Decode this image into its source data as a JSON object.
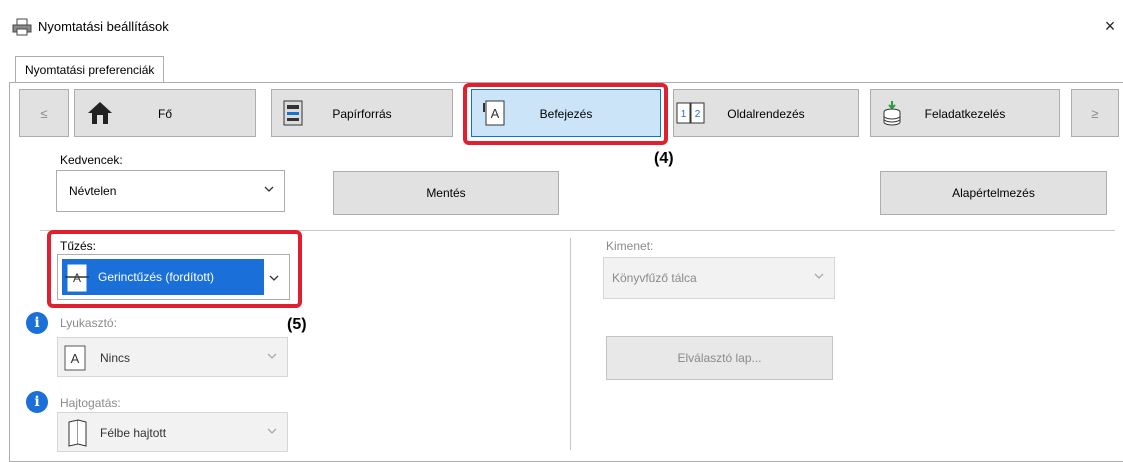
{
  "window": {
    "title": "Nyomtatási beállítások",
    "close": "×"
  },
  "tabs": {
    "active": "Nyomtatási preferenciák"
  },
  "nav": {
    "prev": "≤",
    "next": "≥",
    "items": [
      {
        "label": "Fő",
        "icon": "home-icon"
      },
      {
        "label": "Papírforrás",
        "icon": "paper-tray-icon"
      },
      {
        "label": "Befejezés",
        "icon": "finishing-icon"
      },
      {
        "label": "Oldalrendezés",
        "icon": "page-layout-icon"
      },
      {
        "label": "Feladatkezelés",
        "icon": "job-handling-icon"
      }
    ],
    "active_index": 2
  },
  "favorites": {
    "label": "Kedvencek:",
    "value": "Névtelen",
    "save_label": "Mentés",
    "defaults_label": "Alapértelmezés"
  },
  "stapling": {
    "label": "Tűzés:",
    "value": "Gerinctűzés (fordított)"
  },
  "punch": {
    "label": "Lyukasztó:",
    "value": "Nincs"
  },
  "fold": {
    "label": "Hajtogatás:",
    "value": "Félbe hajtott"
  },
  "output": {
    "label": "Kimenet:",
    "value": "Könyvfűző tálca"
  },
  "separator_page": {
    "label": "Elválasztó lap..."
  },
  "callouts": {
    "step4": "(4)",
    "step5": "(5)"
  },
  "colors": {
    "highlight": "#e0202f",
    "selected": "#1a6fd8",
    "active_tab": "#cce4f7"
  }
}
